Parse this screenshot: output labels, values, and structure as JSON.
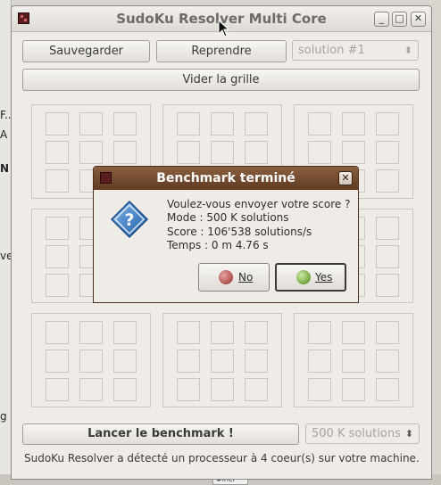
{
  "window": {
    "title": "SudoKu Resolver Multi Core",
    "minimize_glyph": "_",
    "maximize_glyph": "□",
    "close_glyph": "✕"
  },
  "toolbar": {
    "save_label": "Sauvegarder",
    "resume_label": "Reprendre",
    "solution_select_value": "solution #1",
    "clear_grid_label": "Vider la grille"
  },
  "benchmark": {
    "launch_label": "Lancer le benchmark !",
    "size_select_value": "500 K solutions"
  },
  "status": {
    "text": "SudoKu Resolver a détecté un processeur à 4 coeur(s) sur votre machine."
  },
  "dialog": {
    "title": "Benchmark terminé",
    "close_glyph": "✕",
    "question": "Voulez-vous envoyer votre score ?",
    "mode_line": "Mode : 500 K solutions",
    "score_line": "Score : 106'538 solutions/s",
    "time_line": "Temps : 0 m 4.76 s",
    "no_label": "No",
    "yes_label": "Yes"
  },
  "colors": {
    "dialog_title_bg": "#6f4a2f",
    "no_button_dot": "#b85a5a",
    "yes_button_dot": "#7fb04a",
    "question_icon": "#2f6fb8"
  },
  "background_fragments": [
    "F...",
    "A",
    "N",
    "ve",
    "g"
  ],
  "background_tab": "#incl"
}
